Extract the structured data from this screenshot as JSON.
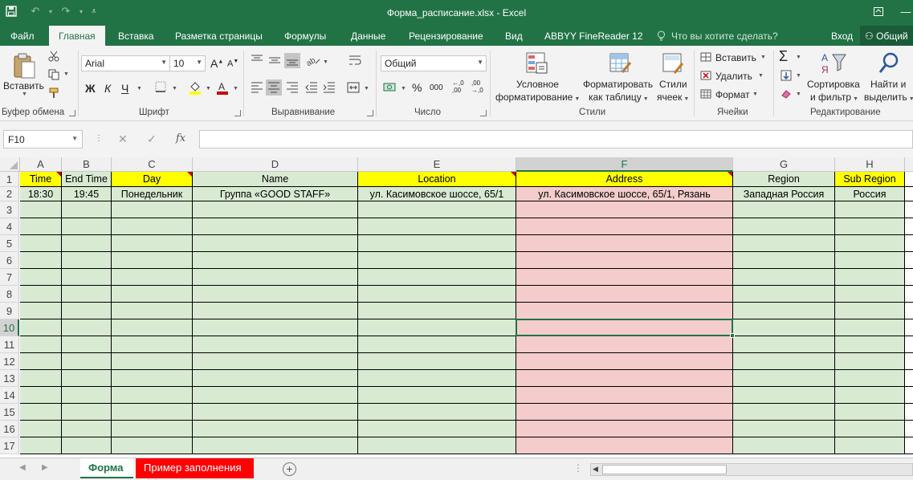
{
  "app": {
    "title": "Форма_расписание.xlsx - Excel",
    "icons": [
      "save-icon",
      "undo-icon",
      "redo-icon",
      "customize-qat-icon",
      "ribbon-display-icon",
      "minimize-icon",
      "restore-icon",
      "close-icon"
    ]
  },
  "tabs": {
    "file": "Файл",
    "home": "Главная",
    "insert": "Вставка",
    "page_layout": "Разметка страницы",
    "formulas": "Формулы",
    "data": "Данные",
    "review": "Рецензирование",
    "view": "Вид",
    "abbyy": "ABBYY FineReader 12",
    "tell_me": "Что вы хотите сделать?",
    "sign_in": "Вход",
    "share": "Общий"
  },
  "ribbon": {
    "clipboard": {
      "paste": "Вставить",
      "label": "Буфер обмена"
    },
    "font": {
      "name": "Arial",
      "size": "10",
      "bold": "Ж",
      "italic": "К",
      "underline": "Ч",
      "label": "Шрифт"
    },
    "alignment": {
      "label": "Выравнивание"
    },
    "number": {
      "format": "Общий",
      "percent": "%",
      "thousands": "000",
      "label": "Число"
    },
    "styles": {
      "conditional_1": "Условное",
      "conditional_2": "форматирование",
      "format_table_1": "Форматировать",
      "format_table_2": "как таблицу",
      "cell_styles_1": "Стили",
      "cell_styles_2": "ячеек",
      "label": "Стили"
    },
    "cells": {
      "insert": "Вставить",
      "delete": "Удалить",
      "format": "Формат",
      "label": "Ячейки"
    },
    "editing": {
      "sort_1": "Сортировка",
      "sort_2": "и фильтр",
      "find_1": "Найти и",
      "find_2": "выделить",
      "label": "Редактирование"
    }
  },
  "formula_bar": {
    "name_box": "F10",
    "fx": "fx",
    "formula": ""
  },
  "grid": {
    "columns": [
      "A",
      "B",
      "C",
      "D",
      "E",
      "F",
      "G",
      "H"
    ],
    "selected_column": "F",
    "rows": [
      "1",
      "2",
      "3",
      "4",
      "5",
      "6",
      "7",
      "8",
      "9",
      "10",
      "11",
      "12",
      "13",
      "14",
      "15",
      "16",
      "17"
    ],
    "selected_row": "10",
    "headers": [
      "Time",
      "End Time",
      "Day",
      "Name",
      "Location",
      "Address",
      "Region",
      "Sub Region"
    ],
    "header_fill": [
      "yellow",
      "green",
      "yellow",
      "green",
      "yellow",
      "yellow",
      "green",
      "yellow"
    ],
    "comment_marker_columns": [
      "A",
      "C",
      "E",
      "F"
    ],
    "row2": [
      "18:30",
      "19:45",
      "Понедельник",
      "Группа «GOOD STAFF»",
      "ул. Касимовское шоссе, 65/1",
      "ул. Касимовское шоссе, 65/1, Рязань",
      "Западная Россия",
      "Россия"
    ],
    "active_cell": "F10",
    "colors": {
      "yellow": "#ffff00",
      "green": "#d9ead3",
      "pink": "#f4cccc",
      "accent": "#217346"
    }
  },
  "sheets": {
    "tabs": [
      "Форма",
      "Пример заполнения"
    ],
    "active": "Форма",
    "tab_colors": {
      "Пример заполнения": "#ff0000"
    }
  }
}
